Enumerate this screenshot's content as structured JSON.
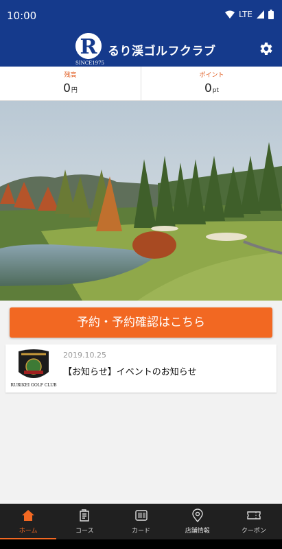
{
  "status_bar": {
    "time": "10:00",
    "network": "LTE"
  },
  "header": {
    "title": "るり渓ゴルフクラブ",
    "logo_letter": "R",
    "logo_since": "SINCE1975"
  },
  "balance": {
    "left": {
      "label": "残高",
      "value": "0",
      "unit": "円"
    },
    "right": {
      "label": "ポイント",
      "value": "0",
      "unit": "pt"
    }
  },
  "reserve_button": "予約・予約確認はこちら",
  "news": [
    {
      "date": "2019.10.25",
      "title": "【お知らせ】イベントのお知らせ",
      "logo_caption": "RURIKEI GOLF CLUB"
    }
  ],
  "nav": [
    {
      "label": "ホーム",
      "icon": "home-icon",
      "active": true
    },
    {
      "label": "コース",
      "icon": "course-icon",
      "active": false
    },
    {
      "label": "カード",
      "icon": "card-icon",
      "active": false
    },
    {
      "label": "店舗情報",
      "icon": "location-pin-icon",
      "active": false
    },
    {
      "label": "クーポン",
      "icon": "coupon-icon",
      "active": false
    }
  ],
  "colors": {
    "header": "#153a8c",
    "accent": "#f26822",
    "nav_bg": "#202020"
  }
}
